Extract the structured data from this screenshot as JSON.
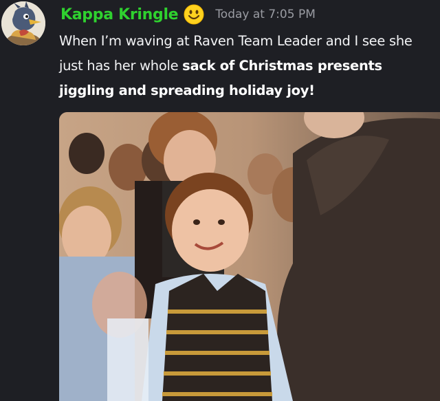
{
  "message": {
    "username": "Kappa Kringle",
    "username_color": "#2fd12f",
    "emoji": "smiley-emoji",
    "timestamp": "Today at 7:05 PM",
    "text_plain": "When I’m waving at Raven Team Leader and I see she just has her whole ",
    "text_bold": "sack of Christmas presents jiggling and spreading holiday joy!"
  },
  "colors": {
    "background": "#1e1f24",
    "text": "#f2f3f5",
    "timestamp": "#9a9ca3"
  },
  "attachment": {
    "type": "image",
    "icon": "meme-photo"
  }
}
